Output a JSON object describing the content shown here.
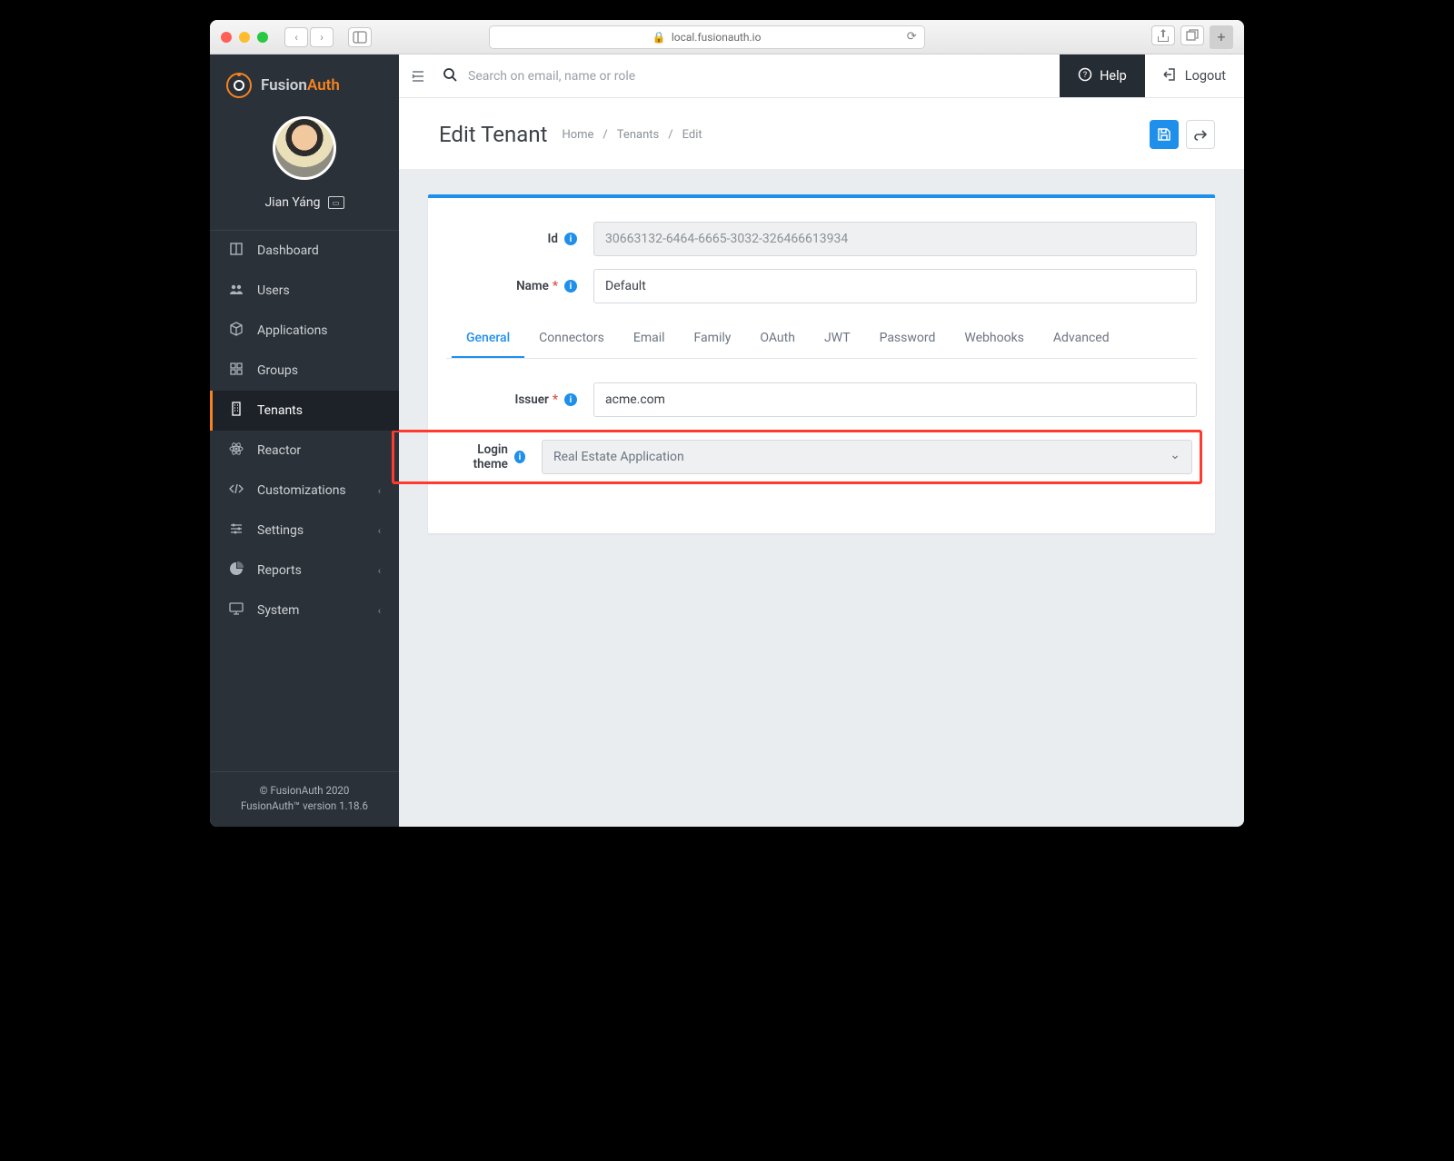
{
  "browser": {
    "url": "local.fusionauth.io"
  },
  "brand": {
    "name_a": "Fusion",
    "name_b": "Auth"
  },
  "user": {
    "name": "Jian Yáng"
  },
  "sidebar": {
    "items": [
      {
        "label": "Dashboard",
        "icon": "dashboard-icon",
        "expandable": false
      },
      {
        "label": "Users",
        "icon": "users-icon",
        "expandable": false
      },
      {
        "label": "Applications",
        "icon": "cube-icon",
        "expandable": false
      },
      {
        "label": "Groups",
        "icon": "groups-icon",
        "expandable": false
      },
      {
        "label": "Tenants",
        "icon": "building-icon",
        "expandable": false,
        "active": true
      },
      {
        "label": "Reactor",
        "icon": "atom-icon",
        "expandable": false
      },
      {
        "label": "Customizations",
        "icon": "code-icon",
        "expandable": true
      },
      {
        "label": "Settings",
        "icon": "sliders-icon",
        "expandable": true
      },
      {
        "label": "Reports",
        "icon": "piechart-icon",
        "expandable": true
      },
      {
        "label": "System",
        "icon": "monitor-icon",
        "expandable": true
      }
    ],
    "footer": {
      "copyright": "© FusionAuth 2020",
      "version": "FusionAuth™ version 1.18.6"
    }
  },
  "topbar": {
    "search_placeholder": "Search on email, name or role",
    "help_label": "Help",
    "logout_label": "Logout"
  },
  "page": {
    "title": "Edit Tenant",
    "breadcrumbs": [
      "Home",
      "Tenants",
      "Edit"
    ]
  },
  "form": {
    "id_label": "Id",
    "id_value": "30663132-6464-6665-3032-326466613934",
    "name_label": "Name",
    "name_value": "Default",
    "issuer_label": "Issuer",
    "issuer_value": "acme.com",
    "theme_label": "Login theme",
    "theme_value": "Real Estate Application",
    "required_marker": "*"
  },
  "tabs": [
    "General",
    "Connectors",
    "Email",
    "Family",
    "OAuth",
    "JWT",
    "Password",
    "Webhooks",
    "Advanced"
  ],
  "active_tab": "General"
}
